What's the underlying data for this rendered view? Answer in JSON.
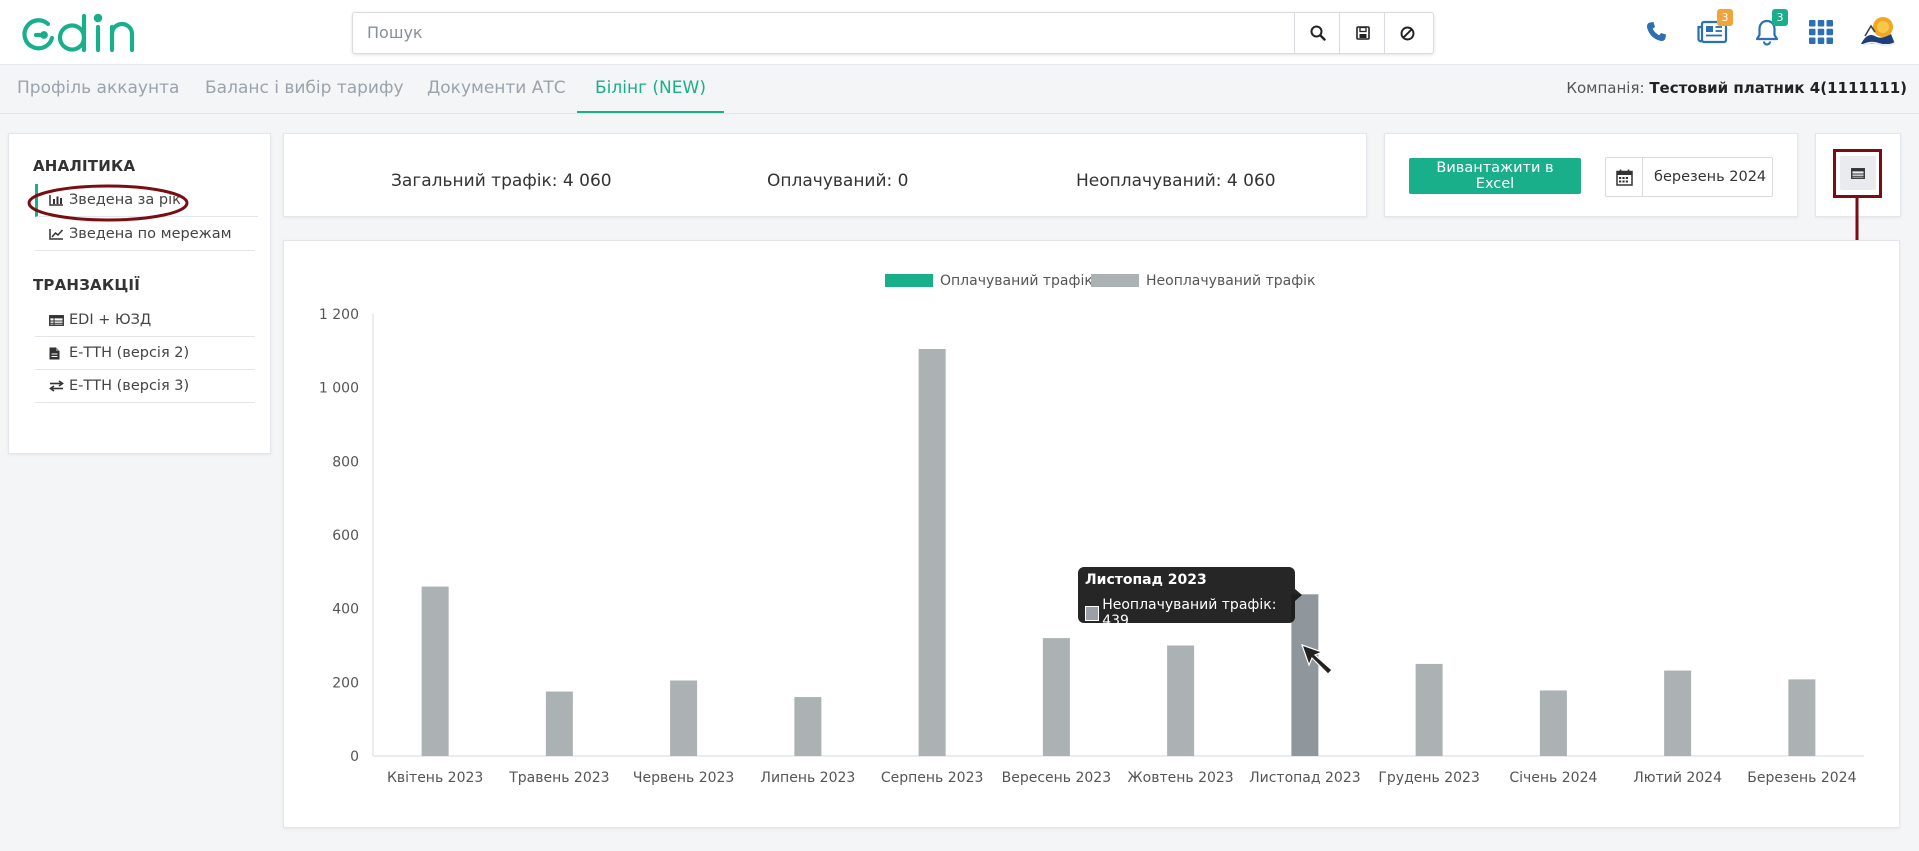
{
  "header": {
    "logo_text": "edin",
    "search": {
      "placeholder": "Пошук",
      "value": ""
    },
    "badges": {
      "news": "3",
      "notifications": "3"
    }
  },
  "tabs": [
    {
      "label": "Профіль аккаунта",
      "active": false
    },
    {
      "label": "Баланс і вибір тарифу",
      "active": false
    },
    {
      "label": "Документи АТС",
      "active": false
    },
    {
      "label": "Білінг (NEW)",
      "active": true
    }
  ],
  "company": {
    "label": "Компанія:",
    "value": "Тестовий платник 4(1111111)"
  },
  "sidebar": {
    "sections": [
      {
        "heading": "АНАЛІТИКА",
        "items": [
          {
            "label": "Зведена за рік",
            "icon": "bar-chart-icon",
            "active": true
          },
          {
            "label": "Зведена по мережам",
            "icon": "line-chart-icon",
            "active": false
          }
        ]
      },
      {
        "heading": "ТРАНЗАКЦІЇ",
        "items": [
          {
            "label": "EDI + ЮЗД",
            "icon": "table-icon",
            "active": false
          },
          {
            "label": "Е-ТТН (версія 2)",
            "icon": "file-icon",
            "active": false
          },
          {
            "label": "Е-ТТН (версія 3)",
            "icon": "exchange-icon",
            "active": false
          }
        ]
      }
    ]
  },
  "stats": {
    "total": "Загальний трафік: 4 060",
    "paid": "Оплачуваний: 0",
    "unpaid": "Неоплачуваний: 4 060"
  },
  "export": {
    "button_label": "Вивантажити в Excel",
    "date_value": "березень 2024"
  },
  "colors": {
    "accent": "#1aaf8b",
    "paid_series": "#1aaf8b",
    "unpaid_series": "#acb1b4",
    "unpaid_hover": "#8f979d",
    "annotation": "#7a0d12"
  },
  "tooltip": {
    "title": "Листопад 2023",
    "text": "Неоплачуваний трафік: 439"
  },
  "chart_data": {
    "type": "bar",
    "categories": [
      "Квітень 2023",
      "Травень 2023",
      "Червень 2023",
      "Липень 2023",
      "Серпень 2023",
      "Вересень 2023",
      "Жовтень 2023",
      "Листопад 2023",
      "Грудень 2023",
      "Січень 2024",
      "Лютий 2024",
      "Березень 2024"
    ],
    "series": [
      {
        "name": "Оплачуваний трафік",
        "values": [
          0,
          0,
          0,
          0,
          0,
          0,
          0,
          0,
          0,
          0,
          0,
          0
        ]
      },
      {
        "name": "Неоплачуваний трафік",
        "values": [
          460,
          175,
          205,
          160,
          1105,
          320,
          300,
          439,
          250,
          178,
          232,
          208
        ]
      }
    ],
    "yticks": [
      "0",
      "200",
      "400",
      "600",
      "800",
      "1 000",
      "1 200"
    ],
    "ylim": [
      0,
      1200
    ],
    "title": "",
    "xlabel": "",
    "ylabel": "",
    "legend_position": "top-center",
    "grid": false,
    "highlighted_category": "Листопад 2023"
  }
}
